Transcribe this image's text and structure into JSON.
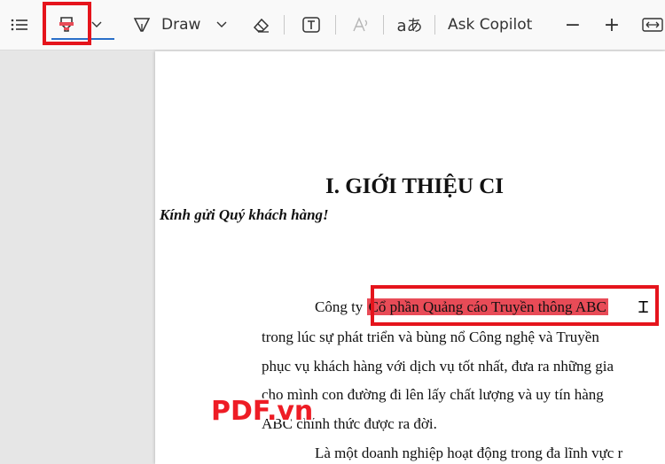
{
  "toolbar": {
    "draw_label": "Draw",
    "ask_copilot_label": "Ask Copilot",
    "zoom_out": "−",
    "zoom_in": "+"
  },
  "document": {
    "heading": "I. GIỚI THIỆU CI",
    "greeting": "Kính gửi Quý khách hàng!",
    "line1_prefix": "Công ty ",
    "line1_highlight": "Cổ phần Quảng cáo Truyền thông ABC",
    "line1_suffix": "",
    "line2": "trong lúc sự phát triển và bùng nổ Công nghệ và Truyền",
    "line3": "phục vụ khách hàng với dịch vụ tốt nhất, đưa ra những gia",
    "line4": "cho mình con đường đi lên lấy chất lượng và uy tín hàng",
    "line5": "ABC chính thức được ra đời.",
    "line6": "Là một doanh nghiệp hoạt động trong đa lĩnh vực r"
  },
  "watermark": "PDF.vn",
  "colors": {
    "highlight": "#e84b57",
    "annotation_box": "#e5141c",
    "accent": "#2a6fc9"
  }
}
